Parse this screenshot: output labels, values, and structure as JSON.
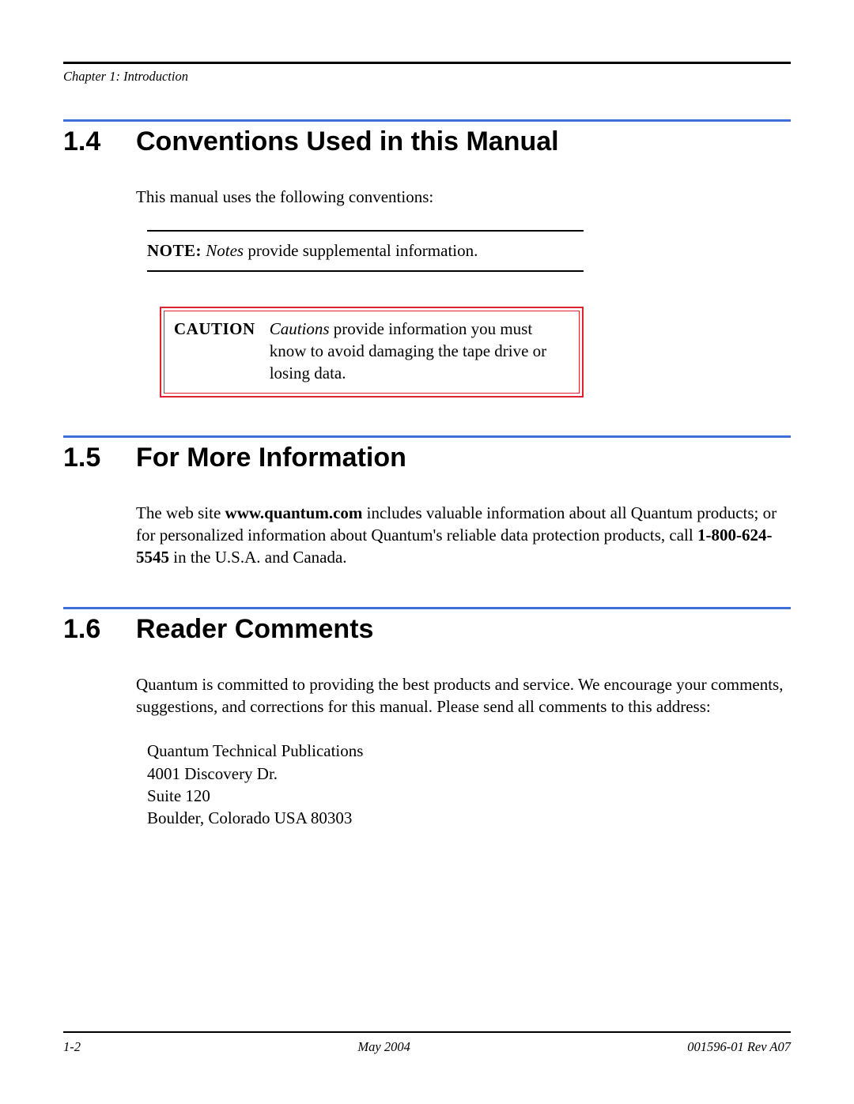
{
  "header": {
    "chapter_line": "Chapter 1:  Introduction"
  },
  "sections": {
    "s14": {
      "number": "1.4",
      "title": "Conventions Used in this Manual",
      "intro": "This manual uses the following conventions:",
      "note": {
        "label": "NOTE:",
        "em": "Notes",
        "rest": " provide supplemental information."
      },
      "caution": {
        "label": "CAUTION",
        "em": "Cautions",
        "rest": " provide information you must know to avoid damaging the tape drive or losing data."
      }
    },
    "s15": {
      "number": "1.5",
      "title": "For More Information",
      "para_pre": "The web site ",
      "site": "www.quantum.com",
      "para_mid": " includes valuable information about all Quantum products; or for personalized information about Quantum's reliable data protection products, call ",
      "phone": "1-800-624-5545",
      "para_post": " in the U.S.A. and Canada."
    },
    "s16": {
      "number": "1.6",
      "title": "Reader Comments",
      "para": "Quantum is committed to providing the best products and service. We encourage your comments, suggestions, and corrections for this manual. Please send all comments to this address:",
      "address": {
        "l1": "Quantum Technical Publications",
        "l2": "4001 Discovery Dr.",
        "l3": "Suite 120",
        "l4": "Boulder, Colorado USA 80303"
      }
    }
  },
  "footer": {
    "left": "1-2",
    "center": "May 2004",
    "right": "001596-01 Rev A07"
  }
}
